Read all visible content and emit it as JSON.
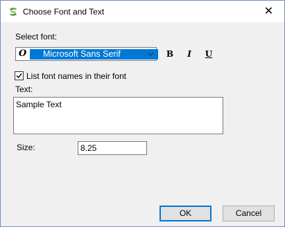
{
  "window": {
    "title": "Choose Font and Text",
    "close_glyph": "✕",
    "app_icon": "logo-icon"
  },
  "font_section": {
    "label": "Select font:",
    "selected_font": "Microsoft Sans Serif",
    "font_type_glyph": "O",
    "bold_label": "B",
    "italic_label": "I",
    "underline_label": "U"
  },
  "options": {
    "list_font_names_label": "List font names in their font",
    "list_font_names_checked": true
  },
  "text_section": {
    "label": "Text:",
    "value": "Sample Text"
  },
  "size_section": {
    "label": "Size:",
    "value": "8.25"
  },
  "buttons": {
    "ok": "OK",
    "cancel": "Cancel"
  },
  "colors": {
    "selection": "#0078d7",
    "default_button_border": "#0078d7",
    "logo_green": "#6aa84f"
  }
}
